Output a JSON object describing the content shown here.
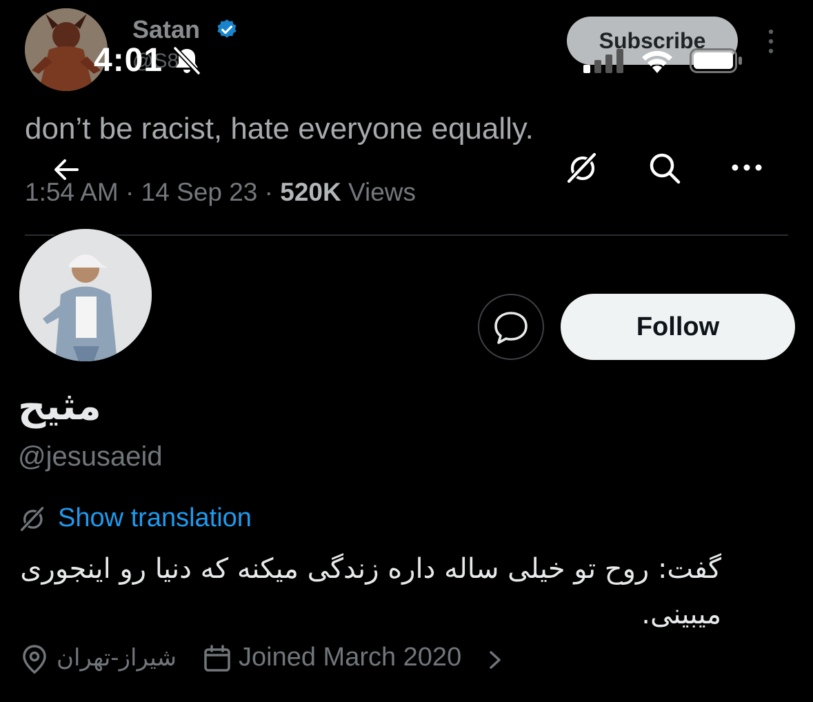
{
  "status_bar": {
    "time": "4:01",
    "icons": [
      "bell-muted-icon",
      "cellular-signal-icon",
      "wifi-icon",
      "battery-icon"
    ]
  },
  "background_tweet": {
    "author_name": "Satan",
    "author_handle": "@S8",
    "verified": true,
    "subscribe_label": "Subscribe",
    "text": "don’t be racist, hate everyone equally.",
    "time": "1:54 AM",
    "date": "14 Sep 23",
    "views_count": "520K",
    "views_label": "Views"
  },
  "header": {
    "icons": [
      "back-arrow-icon",
      "translate-icon",
      "search-icon",
      "more-icon"
    ]
  },
  "profile": {
    "display_name": "مثیح",
    "handle": "@jesusaeid",
    "follow_label": "Follow",
    "show_translation_label": "Show translation",
    "bio": "گفت: روح تو خیلی ساله داره زندگی میکنه که دنیا رو اینجوری میبینی.",
    "location": "شیراز-تهران",
    "joined": "Joined March 2020"
  },
  "colors": {
    "background": "#000000",
    "primary_text": "#e7e9ea",
    "secondary_text": "#71767b",
    "link": "#1d9bf0",
    "follow_button_bg": "#eff3f4",
    "verified_badge": "#1d9bf0"
  }
}
